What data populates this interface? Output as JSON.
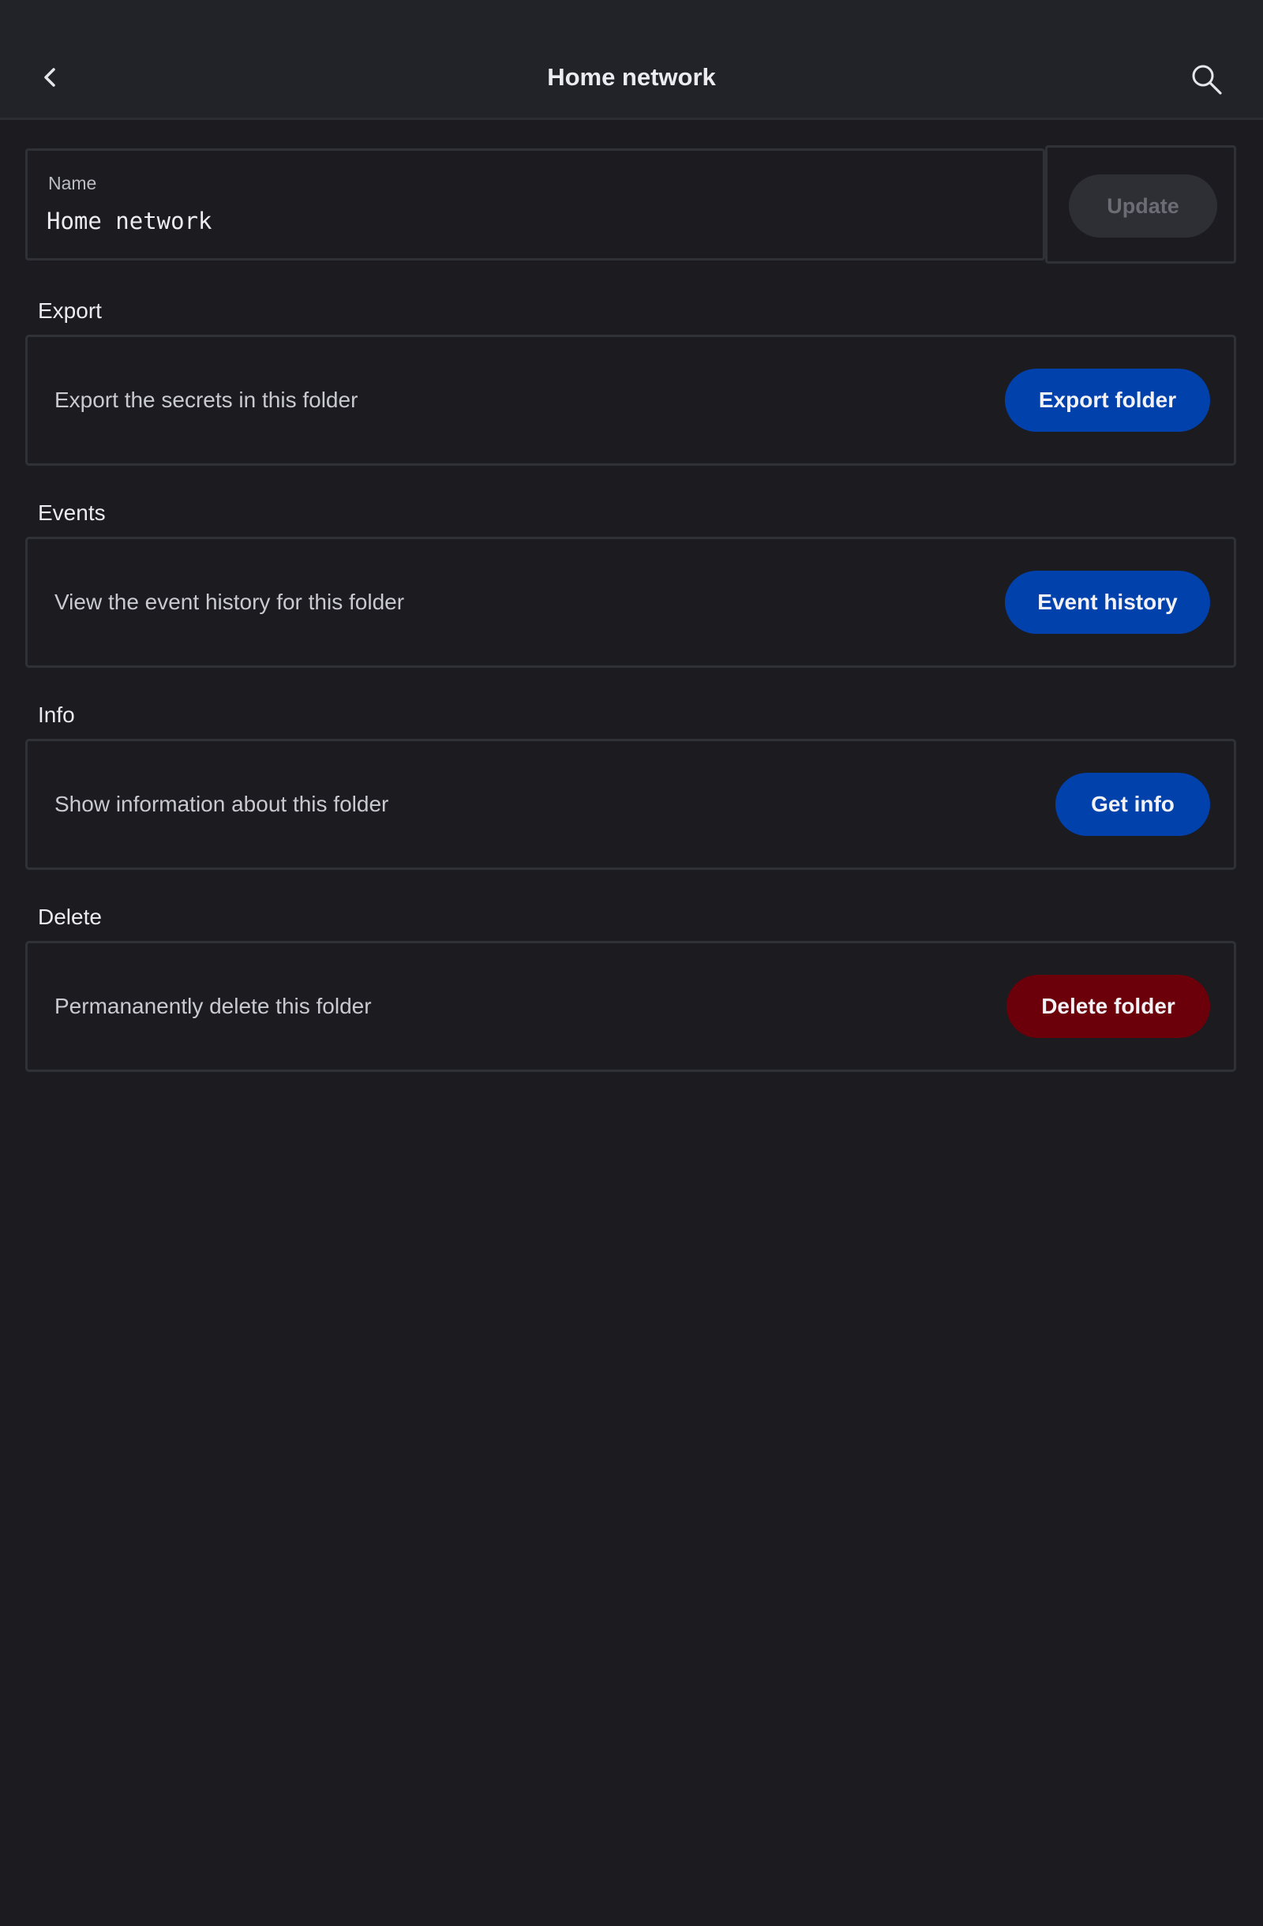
{
  "header": {
    "title": "Home network",
    "back_icon": "chevron-left-icon",
    "search_icon": "search-icon"
  },
  "name_field": {
    "label": "Name",
    "value": "Home network",
    "update_label": "Update"
  },
  "sections": {
    "export": {
      "title": "Export",
      "description": "Export the secrets in this folder",
      "button": "Export folder"
    },
    "events": {
      "title": "Events",
      "description": "View the event history for this folder",
      "button": "Event history"
    },
    "info": {
      "title": "Info",
      "description": "Show information about this folder",
      "button": "Get info"
    },
    "delete": {
      "title": "Delete",
      "description": "Permananently delete this folder",
      "button": "Delete folder"
    }
  },
  "colors": {
    "background": "#1b1b20",
    "primary_button": "#0041ab",
    "danger_button": "#6b000a",
    "disabled_button": "#2e2f35"
  }
}
